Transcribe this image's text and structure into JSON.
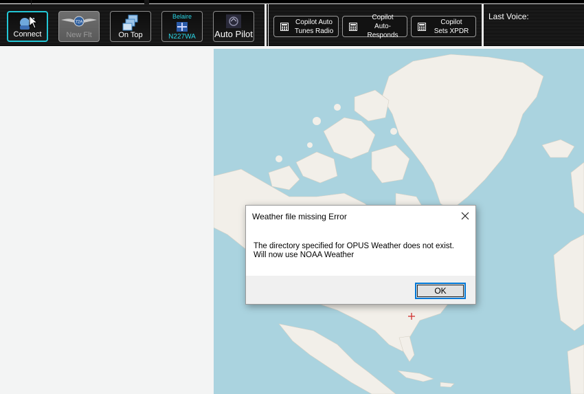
{
  "toolbar": {
    "buttons": [
      {
        "label": "Connect",
        "icon": "connect-icon"
      },
      {
        "label": "New Flt",
        "icon": "wings-logo-icon",
        "badge": "72A"
      },
      {
        "label": "On Top",
        "icon": "stacked-windows-icon"
      },
      {
        "label_top": "Belaire",
        "label_bottom": "N227WA",
        "icon": "aircraft-icon"
      },
      {
        "label": "Auto Pilot",
        "icon": "autopilot-icon"
      }
    ],
    "copilot_buttons": [
      {
        "line1": "Copilot Auto",
        "line2": "Tunes Radio",
        "icon": "calculator-icon"
      },
      {
        "line1": "Copilot",
        "line2": "Auto-Responds",
        "icon": "calculator-icon"
      },
      {
        "line1": "Copilot",
        "line2": "Sets XPDR",
        "icon": "calculator-icon"
      }
    ],
    "last_voice_label": "Last Voice:",
    "accent_color": "#22c7d6"
  },
  "map": {
    "water_color": "#aad3df",
    "land_color": "#f2efe9"
  },
  "dialog": {
    "title": "Weather file missing Error",
    "message_line1": "The directory specified for OPUS Weather does not exist.",
    "message_line2": "Will now use NOAA Weather",
    "ok_label": "OK"
  }
}
